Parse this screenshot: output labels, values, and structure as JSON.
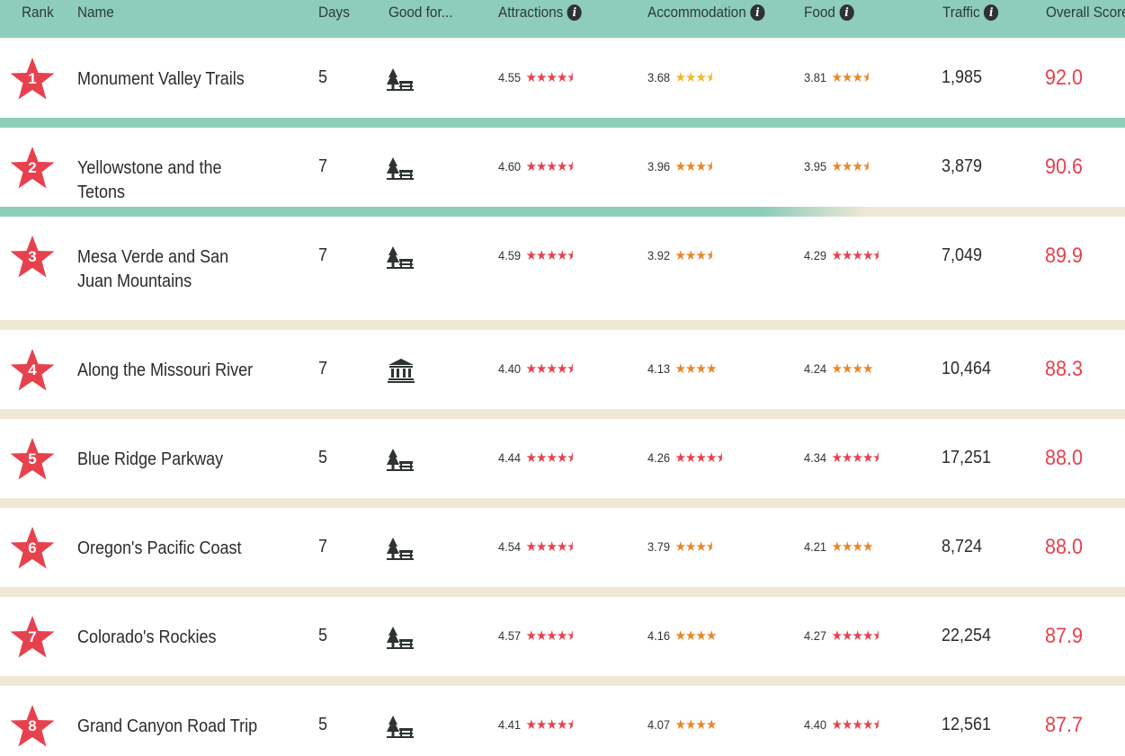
{
  "header": {
    "rank": "Rank",
    "name": "Name",
    "days": "Days",
    "good_for": "Good for...",
    "attractions": "Attractions",
    "accommodation": "Accommodation",
    "food": "Food",
    "traffic": "Traffic",
    "overall_score": "Overall Score"
  },
  "colors": {
    "header_bg": "#8fcdbb",
    "star_red": "#e8414e",
    "star_orange": "#e8872a",
    "star_yellow": "#f2b631",
    "separator": "#efe8d4"
  },
  "rows": [
    {
      "rank": "1",
      "name": "Monument Valley Trails",
      "days": "5",
      "good_for_icon": "nature-icon",
      "attractions": "4.55",
      "accommodation": "3.68",
      "food": "3.81",
      "traffic": "1,985",
      "score": "92.0"
    },
    {
      "rank": "2",
      "name": "Yellowstone and the Tetons",
      "days": "7",
      "good_for_icon": "nature-icon",
      "attractions": "4.60",
      "accommodation": "3.96",
      "food": "3.95",
      "traffic": "3,879",
      "score": "90.6"
    },
    {
      "rank": "3",
      "name": "Mesa Verde and San Juan Mountains",
      "days": "7",
      "good_for_icon": "nature-icon",
      "attractions": "4.59",
      "accommodation": "3.92",
      "food": "4.29",
      "traffic": "7,049",
      "score": "89.9"
    },
    {
      "rank": "4",
      "name": "Along the Missouri River",
      "days": "7",
      "good_for_icon": "museum-icon",
      "attractions": "4.40",
      "accommodation": "4.13",
      "food": "4.24",
      "traffic": "10,464",
      "score": "88.3"
    },
    {
      "rank": "5",
      "name": "Blue Ridge Parkway",
      "days": "5",
      "good_for_icon": "nature-icon",
      "attractions": "4.44",
      "accommodation": "4.26",
      "food": "4.34",
      "traffic": "17,251",
      "score": "88.0"
    },
    {
      "rank": "6",
      "name": "Oregon's Pacific Coast",
      "days": "7",
      "good_for_icon": "nature-icon",
      "attractions": "4.54",
      "accommodation": "3.79",
      "food": "4.21",
      "traffic": "8,724",
      "score": "88.0"
    },
    {
      "rank": "7",
      "name": "Colorado's Rockies",
      "days": "5",
      "good_for_icon": "nature-icon",
      "attractions": "4.57",
      "accommodation": "4.16",
      "food": "4.27",
      "traffic": "22,254",
      "score": "87.9"
    },
    {
      "rank": "8",
      "name": "Grand Canyon Road Trip",
      "days": "5",
      "good_for_icon": "nature-icon",
      "attractions": "4.41",
      "accommodation": "4.07",
      "food": "4.40",
      "traffic": "12,561",
      "score": "87.7"
    }
  ]
}
